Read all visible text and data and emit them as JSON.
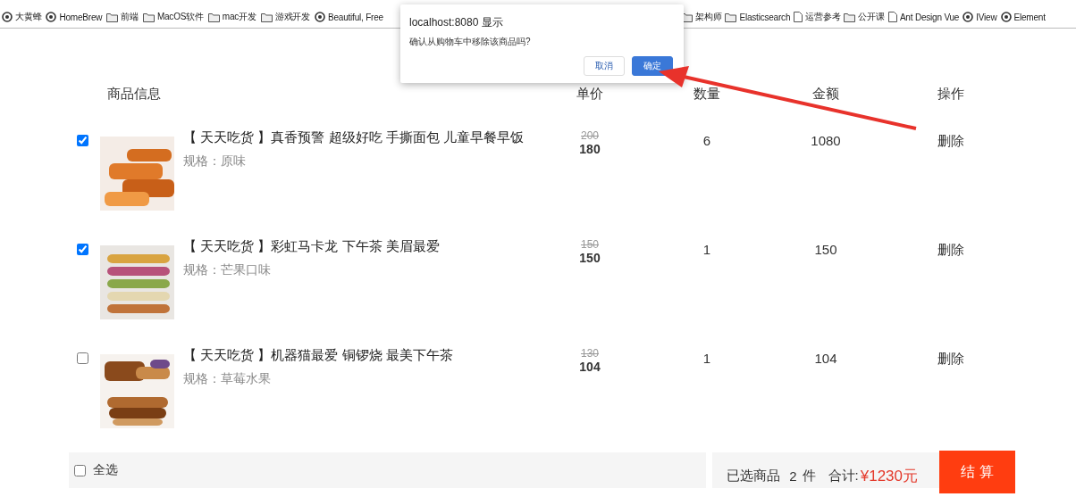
{
  "bookmarks": {
    "left": [
      {
        "label": "大黄蜂",
        "kind": "site"
      },
      {
        "label": "HomeBrew",
        "kind": "site"
      },
      {
        "label": "前端",
        "kind": "folder"
      },
      {
        "label": "MacOS软件",
        "kind": "folder"
      },
      {
        "label": "mac开发",
        "kind": "folder"
      },
      {
        "label": "游戏开发",
        "kind": "folder"
      },
      {
        "label": "Beautiful, Free",
        "kind": "site"
      }
    ],
    "right": [
      {
        "label": "架构师",
        "kind": "folder"
      },
      {
        "label": "Elasticsearch",
        "kind": "folder"
      },
      {
        "label": "运营参考",
        "kind": "page"
      },
      {
        "label": "公开课",
        "kind": "folder"
      },
      {
        "label": "Ant Design Vue",
        "kind": "page"
      },
      {
        "label": "IView",
        "kind": "site"
      },
      {
        "label": "Element",
        "kind": "site"
      }
    ]
  },
  "table": {
    "columns": [
      "商品信息",
      "单价",
      "数量",
      "金额",
      "操作"
    ],
    "rows": [
      {
        "checked": true,
        "title": "【 天天吃货 】真香预警 超级好吃 手撕面包 儿童早餐早饭",
        "spec": "规格：原味",
        "original_price": "200",
        "price": "180",
        "quantity": "6",
        "amount": "1080",
        "action": "删除"
      },
      {
        "checked": true,
        "title": "【 天天吃货 】彩虹马卡龙 下午茶 美眉最爱",
        "spec": "规格：芒果口味",
        "original_price": "150",
        "price": "150",
        "quantity": "1",
        "amount": "150",
        "action": "删除"
      },
      {
        "checked": false,
        "title": "【 天天吃货 】机器猫最爱 铜锣烧 最美下午茶",
        "spec": "规格：草莓水果",
        "original_price": "130",
        "price": "104",
        "quantity": "1",
        "amount": "104",
        "action": "删除"
      }
    ]
  },
  "footer": {
    "select_all": {
      "label": "全选",
      "checked": false
    },
    "selected_label": "已选商品",
    "selected_count": "2",
    "selected_unit": "件",
    "total_label": "合计:",
    "total": "¥1230元",
    "checkout": "结 算"
  },
  "dialog": {
    "title": "localhost:8080 显示",
    "message": "确认从购物车中移除该商品吗?",
    "buttons": [
      {
        "label": "取消",
        "kind": "secondary"
      },
      {
        "label": "确定",
        "kind": "primary"
      }
    ]
  }
}
